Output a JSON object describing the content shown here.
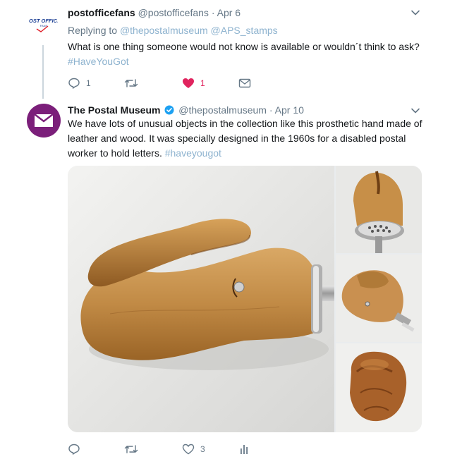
{
  "tweets": [
    {
      "name": "postofficefans",
      "handle": "@postofficefans",
      "date": "Apr 6",
      "avatar_text": "POST OFFICE",
      "avatar_subtext": "FANS",
      "reply_label": "Replying to",
      "reply_handles": [
        "@thepostalmuseum",
        "@APS_stamps"
      ],
      "text": "What is one thing someone would not know is available or wouldn´t think to ask?",
      "hashtag": "#HaveYouGot",
      "actions": {
        "reply_count": "1",
        "retweet_count": "",
        "like_count": "1"
      }
    },
    {
      "name": "The Postal Museum",
      "handle": "@thepostalmuseum",
      "date": "Apr 10",
      "verified": true,
      "text": "We have lots of unusual objects in the collection like this prosthetic hand made of leather and wood. It was specially designed in the 1960s for a disabled postal worker to hold letters.",
      "hashtag": "#haveyougot",
      "actions": {
        "reply_count": "",
        "retweet_count": "",
        "like_count": "3"
      }
    }
  ],
  "separator": "·",
  "colors": {
    "brand_blue": "#1da1f2",
    "link": "#3b94d9",
    "muted": "#657786",
    "heart": "#e0245e",
    "museum_purple": "#7b1f7a"
  },
  "icons": [
    "reply-icon",
    "retweet-icon",
    "like-icon",
    "message-icon",
    "analytics-icon",
    "chevron-down-icon",
    "verified-icon",
    "envelope-icon"
  ]
}
